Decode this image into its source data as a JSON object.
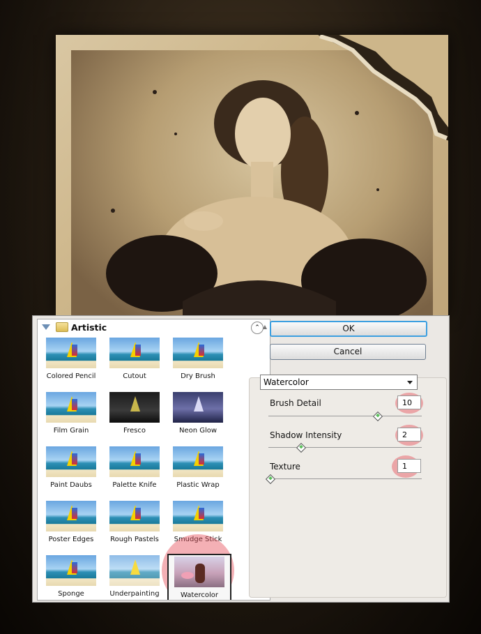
{
  "gallery": {
    "category": "Artistic",
    "filters": [
      {
        "label": "Colored Pencil"
      },
      {
        "label": "Cutout"
      },
      {
        "label": "Dry Brush"
      },
      {
        "label": "Film Grain"
      },
      {
        "label": "Fresco"
      },
      {
        "label": "Neon Glow"
      },
      {
        "label": "Paint Daubs"
      },
      {
        "label": "Palette Knife"
      },
      {
        "label": "Plastic Wrap"
      },
      {
        "label": "Poster Edges"
      },
      {
        "label": "Rough Pastels"
      },
      {
        "label": "Smudge Stick"
      },
      {
        "label": "Sponge"
      },
      {
        "label": "Underpainting"
      },
      {
        "label": "Watercolor"
      }
    ],
    "selected": "Watercolor"
  },
  "buttons": {
    "ok": "OK",
    "cancel": "Cancel"
  },
  "filter_select": {
    "value": "Watercolor"
  },
  "params": [
    {
      "label": "Brush Detail",
      "value": "10",
      "level": 0.72
    },
    {
      "label": "Shadow Intensity",
      "value": "2",
      "level": 0.2
    },
    {
      "label": "Texture",
      "value": "1",
      "level": 0.0
    }
  ],
  "colors": {
    "ok_border": "#3c9fe0",
    "highlight": "#e6505a"
  }
}
